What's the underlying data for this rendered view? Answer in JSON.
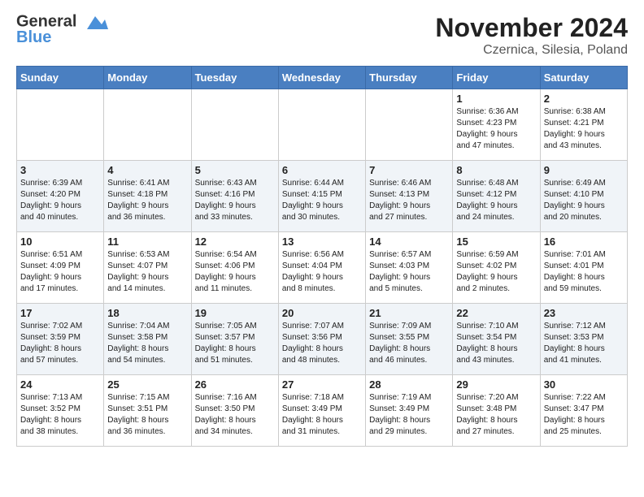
{
  "header": {
    "logo_line1": "General",
    "logo_line2": "Blue",
    "title": "November 2024",
    "subtitle": "Czernica, Silesia, Poland"
  },
  "days_of_week": [
    "Sunday",
    "Monday",
    "Tuesday",
    "Wednesday",
    "Thursday",
    "Friday",
    "Saturday"
  ],
  "weeks": [
    [
      {
        "day": "",
        "info": ""
      },
      {
        "day": "",
        "info": ""
      },
      {
        "day": "",
        "info": ""
      },
      {
        "day": "",
        "info": ""
      },
      {
        "day": "",
        "info": ""
      },
      {
        "day": "1",
        "info": "Sunrise: 6:36 AM\nSunset: 4:23 PM\nDaylight: 9 hours\nand 47 minutes."
      },
      {
        "day": "2",
        "info": "Sunrise: 6:38 AM\nSunset: 4:21 PM\nDaylight: 9 hours\nand 43 minutes."
      }
    ],
    [
      {
        "day": "3",
        "info": "Sunrise: 6:39 AM\nSunset: 4:20 PM\nDaylight: 9 hours\nand 40 minutes."
      },
      {
        "day": "4",
        "info": "Sunrise: 6:41 AM\nSunset: 4:18 PM\nDaylight: 9 hours\nand 36 minutes."
      },
      {
        "day": "5",
        "info": "Sunrise: 6:43 AM\nSunset: 4:16 PM\nDaylight: 9 hours\nand 33 minutes."
      },
      {
        "day": "6",
        "info": "Sunrise: 6:44 AM\nSunset: 4:15 PM\nDaylight: 9 hours\nand 30 minutes."
      },
      {
        "day": "7",
        "info": "Sunrise: 6:46 AM\nSunset: 4:13 PM\nDaylight: 9 hours\nand 27 minutes."
      },
      {
        "day": "8",
        "info": "Sunrise: 6:48 AM\nSunset: 4:12 PM\nDaylight: 9 hours\nand 24 minutes."
      },
      {
        "day": "9",
        "info": "Sunrise: 6:49 AM\nSunset: 4:10 PM\nDaylight: 9 hours\nand 20 minutes."
      }
    ],
    [
      {
        "day": "10",
        "info": "Sunrise: 6:51 AM\nSunset: 4:09 PM\nDaylight: 9 hours\nand 17 minutes."
      },
      {
        "day": "11",
        "info": "Sunrise: 6:53 AM\nSunset: 4:07 PM\nDaylight: 9 hours\nand 14 minutes."
      },
      {
        "day": "12",
        "info": "Sunrise: 6:54 AM\nSunset: 4:06 PM\nDaylight: 9 hours\nand 11 minutes."
      },
      {
        "day": "13",
        "info": "Sunrise: 6:56 AM\nSunset: 4:04 PM\nDaylight: 9 hours\nand 8 minutes."
      },
      {
        "day": "14",
        "info": "Sunrise: 6:57 AM\nSunset: 4:03 PM\nDaylight: 9 hours\nand 5 minutes."
      },
      {
        "day": "15",
        "info": "Sunrise: 6:59 AM\nSunset: 4:02 PM\nDaylight: 9 hours\nand 2 minutes."
      },
      {
        "day": "16",
        "info": "Sunrise: 7:01 AM\nSunset: 4:01 PM\nDaylight: 8 hours\nand 59 minutes."
      }
    ],
    [
      {
        "day": "17",
        "info": "Sunrise: 7:02 AM\nSunset: 3:59 PM\nDaylight: 8 hours\nand 57 minutes."
      },
      {
        "day": "18",
        "info": "Sunrise: 7:04 AM\nSunset: 3:58 PM\nDaylight: 8 hours\nand 54 minutes."
      },
      {
        "day": "19",
        "info": "Sunrise: 7:05 AM\nSunset: 3:57 PM\nDaylight: 8 hours\nand 51 minutes."
      },
      {
        "day": "20",
        "info": "Sunrise: 7:07 AM\nSunset: 3:56 PM\nDaylight: 8 hours\nand 48 minutes."
      },
      {
        "day": "21",
        "info": "Sunrise: 7:09 AM\nSunset: 3:55 PM\nDaylight: 8 hours\nand 46 minutes."
      },
      {
        "day": "22",
        "info": "Sunrise: 7:10 AM\nSunset: 3:54 PM\nDaylight: 8 hours\nand 43 minutes."
      },
      {
        "day": "23",
        "info": "Sunrise: 7:12 AM\nSunset: 3:53 PM\nDaylight: 8 hours\nand 41 minutes."
      }
    ],
    [
      {
        "day": "24",
        "info": "Sunrise: 7:13 AM\nSunset: 3:52 PM\nDaylight: 8 hours\nand 38 minutes."
      },
      {
        "day": "25",
        "info": "Sunrise: 7:15 AM\nSunset: 3:51 PM\nDaylight: 8 hours\nand 36 minutes."
      },
      {
        "day": "26",
        "info": "Sunrise: 7:16 AM\nSunset: 3:50 PM\nDaylight: 8 hours\nand 34 minutes."
      },
      {
        "day": "27",
        "info": "Sunrise: 7:18 AM\nSunset: 3:49 PM\nDaylight: 8 hours\nand 31 minutes."
      },
      {
        "day": "28",
        "info": "Sunrise: 7:19 AM\nSunset: 3:49 PM\nDaylight: 8 hours\nand 29 minutes."
      },
      {
        "day": "29",
        "info": "Sunrise: 7:20 AM\nSunset: 3:48 PM\nDaylight: 8 hours\nand 27 minutes."
      },
      {
        "day": "30",
        "info": "Sunrise: 7:22 AM\nSunset: 3:47 PM\nDaylight: 8 hours\nand 25 minutes."
      }
    ]
  ]
}
